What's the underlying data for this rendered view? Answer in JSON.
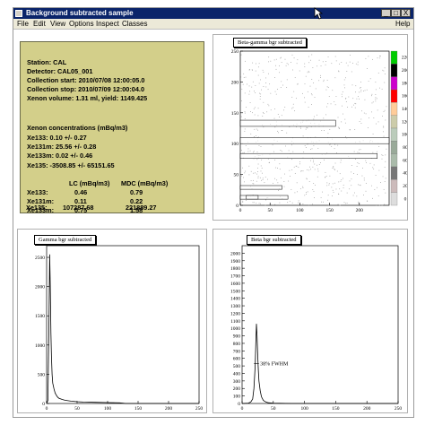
{
  "window": {
    "title": "Background subtracted sample",
    "buttons": {
      "minimize": "_",
      "maximize": "□",
      "close": "X"
    }
  },
  "menu": {
    "items": [
      "File",
      "Edit",
      "View",
      "Options",
      "Inspect",
      "Classes"
    ],
    "help": "Help"
  },
  "info": {
    "lines": [
      "Station: CAL",
      "Detector: CAL05_001",
      "Collection start: 2010/07/08 12:00:05.0",
      "Collection stop: 2010/07/09 12:00:04.0",
      "Xenon volume: 1.31 ml, yield: 1149.425",
      "Xenon concentrations (mBq/m3)",
      "Xe133:    0.10  +/-  0.27",
      "Xe131m:  25.56  +/-  0.28",
      "Xe133m:  0.02  +/-  0.46",
      "Xe135:    -3508.85  +/-  65151.65",
      "LC (mBq/m3)",
      "MDC (mBq/m3)",
      "Xe133:",
      "Xe131m:",
      "Xe133m:",
      "Xe135:"
    ],
    "lc": [
      "0.46",
      "0.11",
      "0.75",
      "107287.68"
    ],
    "mdc": [
      "0.79",
      "0.22",
      "1.58",
      "221889.27"
    ]
  },
  "panels": {
    "beta_gamma": {
      "title": "Beta-gamma bgr subtracted",
      "palette_labels": [
        "220",
        "200",
        "180",
        "160",
        "140",
        "120",
        "100",
        "80",
        "60",
        "40",
        "20",
        "0"
      ],
      "palette_colors": [
        "#00cc00",
        "#000000",
        "#cc00cc",
        "#ff0000",
        "#ffcc99",
        "#ccccaa",
        "#bbccbb",
        "#99aa99",
        "#aabbaa",
        "#777777",
        "#ccbbbb",
        "#dddddd"
      ]
    },
    "gamma": {
      "title": "Gamma bgr subtracted"
    },
    "beta": {
      "title": "Beta bgr subtracted",
      "annotation": "38% FWHM"
    }
  },
  "chart_data": [
    {
      "type": "heatmap",
      "title": "Beta-gamma bgr subtracted",
      "xlim": [
        0,
        250
      ],
      "ylim": [
        0,
        250
      ],
      "x_ticks": [
        0,
        50,
        100,
        150,
        200
      ],
      "y_ticks": [
        0,
        50,
        100,
        150,
        200,
        250
      ],
      "boxes": [
        {
          "x0": 0,
          "x1": 160,
          "y0": 128,
          "y1": 138
        },
        {
          "x0": 0,
          "x1": 250,
          "y0": 100,
          "y1": 110
        },
        {
          "x0": 0,
          "x1": 230,
          "y0": 76,
          "y1": 84
        },
        {
          "x0": 0,
          "x1": 70,
          "y0": 26,
          "y1": 32
        },
        {
          "x0": 0,
          "x1": 80,
          "y0": 10,
          "y1": 16
        },
        {
          "x0": 10,
          "x1": 30,
          "y0": 10,
          "y1": 16
        }
      ],
      "z_scale": [
        0,
        20,
        40,
        60,
        80,
        100,
        120,
        140,
        160,
        180,
        200,
        220
      ]
    },
    {
      "type": "line",
      "title": "Gamma bgr subtracted",
      "xlim": [
        0,
        250
      ],
      "ylim": [
        0,
        2700
      ],
      "x_ticks": [
        0,
        50,
        100,
        150,
        200,
        250
      ],
      "y_ticks": [
        0,
        500,
        1000,
        1500,
        2000,
        2500
      ],
      "x": [
        0,
        2,
        4,
        5,
        6,
        7,
        8,
        9,
        10,
        12,
        14,
        16,
        18,
        20,
        25,
        30,
        40,
        50,
        60,
        80,
        100,
        120,
        130,
        250
      ],
      "y": [
        0,
        50,
        1500,
        2550,
        2000,
        1200,
        800,
        500,
        350,
        250,
        180,
        140,
        110,
        90,
        70,
        55,
        40,
        30,
        25,
        20,
        15,
        10,
        0,
        0
      ]
    },
    {
      "type": "line",
      "title": "Beta bgr subtracted",
      "xlim": [
        0,
        250
      ],
      "ylim": [
        0,
        2100
      ],
      "x_ticks": [
        0,
        50,
        100,
        150,
        200,
        250
      ],
      "y_ticks": [
        0,
        100,
        200,
        300,
        400,
        500,
        600,
        700,
        800,
        900,
        1000,
        1100,
        1200,
        1300,
        1400,
        1500,
        1600,
        1700,
        1800,
        1900,
        2000
      ],
      "x": [
        0,
        10,
        14,
        17,
        19,
        21,
        22,
        23,
        24,
        25,
        26,
        27,
        29,
        31,
        34,
        38,
        42,
        50,
        60,
        80,
        250
      ],
      "y": [
        0,
        5,
        20,
        60,
        200,
        500,
        800,
        1060,
        900,
        650,
        450,
        300,
        170,
        90,
        40,
        20,
        10,
        5,
        2,
        0,
        0
      ]
    }
  ]
}
